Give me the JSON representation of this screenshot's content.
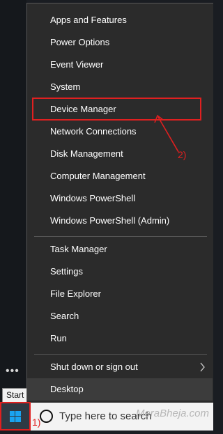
{
  "menu": {
    "items": [
      {
        "label": "Apps and Features"
      },
      {
        "label": "Power Options"
      },
      {
        "label": "Event Viewer"
      },
      {
        "label": "System"
      },
      {
        "label": "Device Manager"
      },
      {
        "label": "Network Connections"
      },
      {
        "label": "Disk Management"
      },
      {
        "label": "Computer Management"
      },
      {
        "label": "Windows PowerShell"
      },
      {
        "label": "Windows PowerShell (Admin)"
      },
      {
        "label": "Task Manager"
      },
      {
        "label": "Settings"
      },
      {
        "label": "File Explorer"
      },
      {
        "label": "Search"
      },
      {
        "label": "Run"
      },
      {
        "label": "Shut down or sign out"
      },
      {
        "label": "Desktop"
      }
    ]
  },
  "taskbar": {
    "start_tooltip": "Start",
    "search_placeholder": "Type here to search",
    "watermark": "MeraBheja.com"
  },
  "annotations": {
    "step1": "1)",
    "step2": "2)",
    "color": "#e02020"
  },
  "icons": [
    "windows-logo-icon",
    "search-icon",
    "chevron-right-icon",
    "more-dots-icon"
  ]
}
